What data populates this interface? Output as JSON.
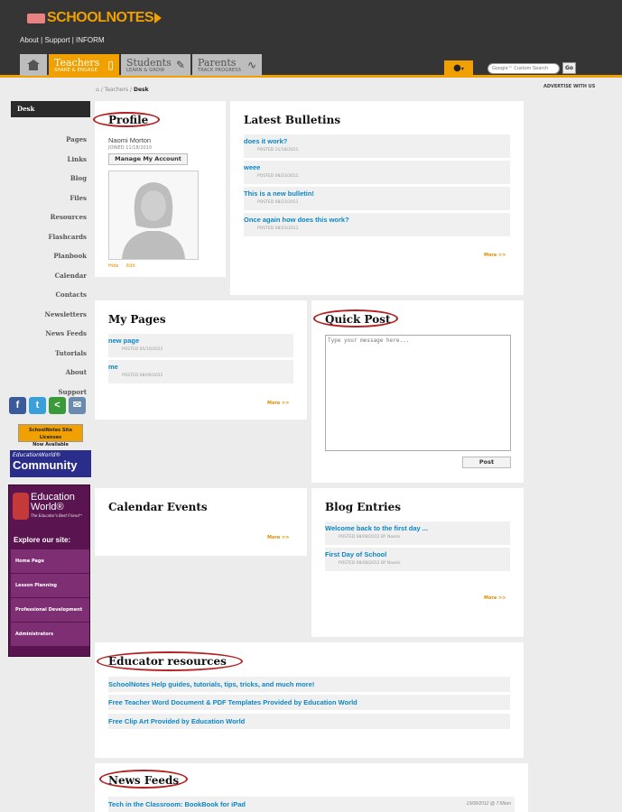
{
  "header": {
    "logo": "SCHOOLNOTES",
    "links": {
      "about": "About",
      "support": "Support",
      "inform": "INFORM",
      "sep": "|"
    },
    "tabs": [
      {
        "title": "Teachers",
        "sub": "SHARE & ENGAGE"
      },
      {
        "title": "Students",
        "sub": "LEARN & GROW"
      },
      {
        "title": "Parents",
        "sub": "TRACK PROGRESS"
      }
    ],
    "search_placeholder": "Google™ Custom Search",
    "go_label": "Go"
  },
  "breadcrumb": {
    "sep": "/",
    "teachers": "Teachers",
    "desk": "Desk"
  },
  "advertise": "ADVERTISE WITH US",
  "sidebar": {
    "active": "Desk",
    "items": [
      "Pages",
      "Links",
      "Blog",
      "Files",
      "Resources",
      "Flashcards",
      "Planbook",
      "Calendar",
      "Contacts",
      "Newsletters",
      "News Feeds",
      "Tutorials",
      "About",
      "Support"
    ]
  },
  "social": {
    "facebook": "f",
    "twitter": "t",
    "share": "<",
    "email": "✉"
  },
  "license_banner": {
    "line1": "SchoolNotes Site Licenses",
    "line2": "Now Available"
  },
  "ew_community": {
    "small": "EducationWorld®",
    "big": "Community"
  },
  "ew_box": {
    "name1": "Education",
    "name2": "World®",
    "tagline": "The Educator's Best Friend™",
    "explore": "Explore our site:",
    "links": [
      "Home Page",
      "Lesson Planning",
      "Professional Development",
      "Administrators"
    ]
  },
  "profile": {
    "title": "Profile",
    "name": "Naomi Morton",
    "joined": "JOINED 11/18/2010",
    "manage_label": "Manage My Account",
    "hide": "Hide",
    "edit": "Edit"
  },
  "bulletins": {
    "title": "Latest Bulletins",
    "items": [
      {
        "title": "does it work?",
        "date": "POSTED 11/18/2011"
      },
      {
        "title": "weee",
        "date": "POSTED 08/23/2011"
      },
      {
        "title": "This is a new bulletin!",
        "date": "POSTED 08/23/2011"
      },
      {
        "title": "Once again how does this work?",
        "date": "POSTED 08/23/2011"
      }
    ],
    "more": "More >>"
  },
  "mypages": {
    "title": "My Pages",
    "items": [
      {
        "title": "new page",
        "date": "POSTED 05/10/2012"
      },
      {
        "title": "me",
        "date": "POSTED 08/09/2012"
      }
    ],
    "more": "More >>"
  },
  "quickpost": {
    "title": "Quick Post",
    "placeholder": "Type your message here...",
    "post_label": "Post"
  },
  "calendar": {
    "title": "Calendar Events",
    "more": "More >>"
  },
  "blog": {
    "title": "Blog Entries",
    "items": [
      {
        "title": "Welcome back to the first day ...",
        "date": "POSTED 08/08/2012 BY Naomi"
      },
      {
        "title": "First Day of School",
        "date": "POSTED 08/08/2012 BY Naomi"
      }
    ],
    "more": "More >>"
  },
  "resources": {
    "title": "Educator resources",
    "links": [
      "SchoolNotes Help guides, tutorials, tips, tricks, and much more!",
      "Free Teacher Word Document & PDF Templates Provided by Education World",
      "Free Clip Art Provided by Education World"
    ]
  },
  "newsfeeds": {
    "title": "News Feeds",
    "item": {
      "title": "Tech in the Classroom: BookBook for iPad",
      "date": "13/08/2012 @ 7:58am"
    }
  },
  "colors": {
    "accent": "#f0a000",
    "link": "#0b86c4",
    "header_bg": "#353535",
    "highlight_oval": "#b52020"
  }
}
